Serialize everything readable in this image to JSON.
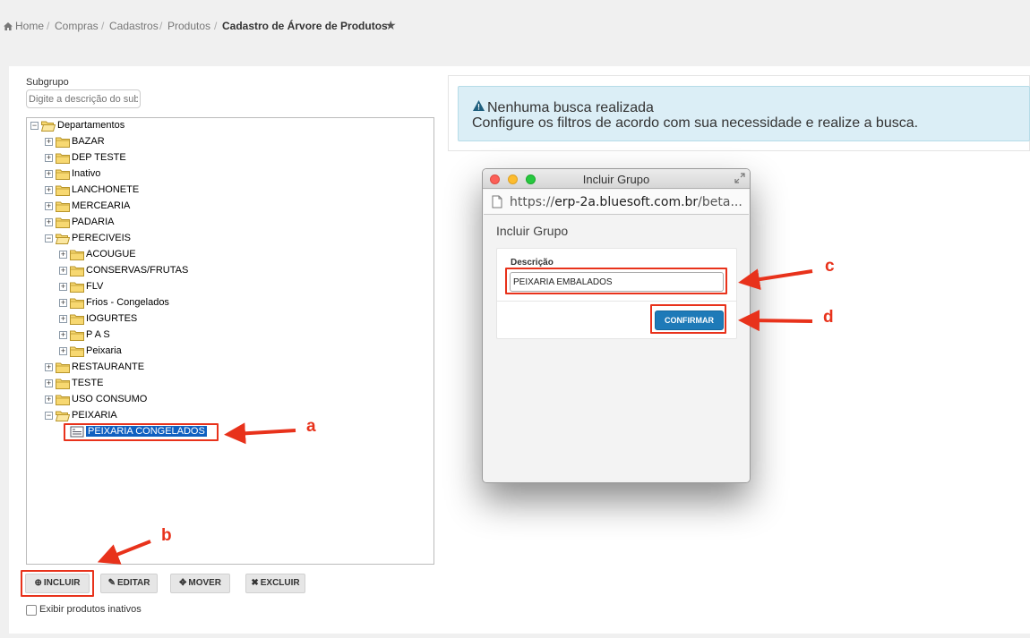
{
  "breadcrumb": {
    "home": "Home",
    "compras": "Compras",
    "cadastros": "Cadastros",
    "produtos": "Produtos",
    "current": "Cadastro de Árvore de Produtos",
    "separator": "/"
  },
  "filter": {
    "label": "Subgrupo",
    "placeholder": "Digite a descrição do sub"
  },
  "tree": {
    "root": "Departamentos",
    "items": [
      "BAZAR",
      "DEP TESTE",
      "Inativo",
      "LANCHONETE",
      "MERCEARIA",
      "PADARIA",
      "PERECIVEIS",
      "ACOUGUE",
      "CONSERVAS/FRUTAS",
      "FLV",
      "Frios - Congelados",
      "IOGURTES",
      "P A S",
      "Peixaria",
      "RESTAURANTE",
      "TESTE",
      "USO CONSUMO",
      "PEIXARIA",
      "PEIXARIA CONGELADOS"
    ]
  },
  "actions": {
    "incluir": "INCLUIR",
    "editar": "EDITAR",
    "mover": "MOVER",
    "excluir": "EXCLUIR",
    "show_inactive": "Exibir produtos inativos"
  },
  "alert": {
    "title": "Nenhuma busca realizada",
    "message": "Configure os filtros de acordo com sua necessidade e realize a busca."
  },
  "popup": {
    "window_title": "Incluir Grupo",
    "url_scheme": "https://",
    "url_host": "erp-2a.bluesoft.com.br",
    "url_rest": "/beta...",
    "heading": "Incluir Grupo",
    "field_label": "Descrição",
    "field_value": "PEIXARIA EMBALADOS",
    "confirm": "CONFIRMAR"
  },
  "annotations": {
    "a": "a",
    "b": "b",
    "c": "c",
    "d": "d"
  },
  "colors": {
    "annotation": "#e8321b",
    "confirm_button": "#1e7ab8",
    "selection": "#1060c0",
    "alert_bg": "#dbeef6"
  }
}
